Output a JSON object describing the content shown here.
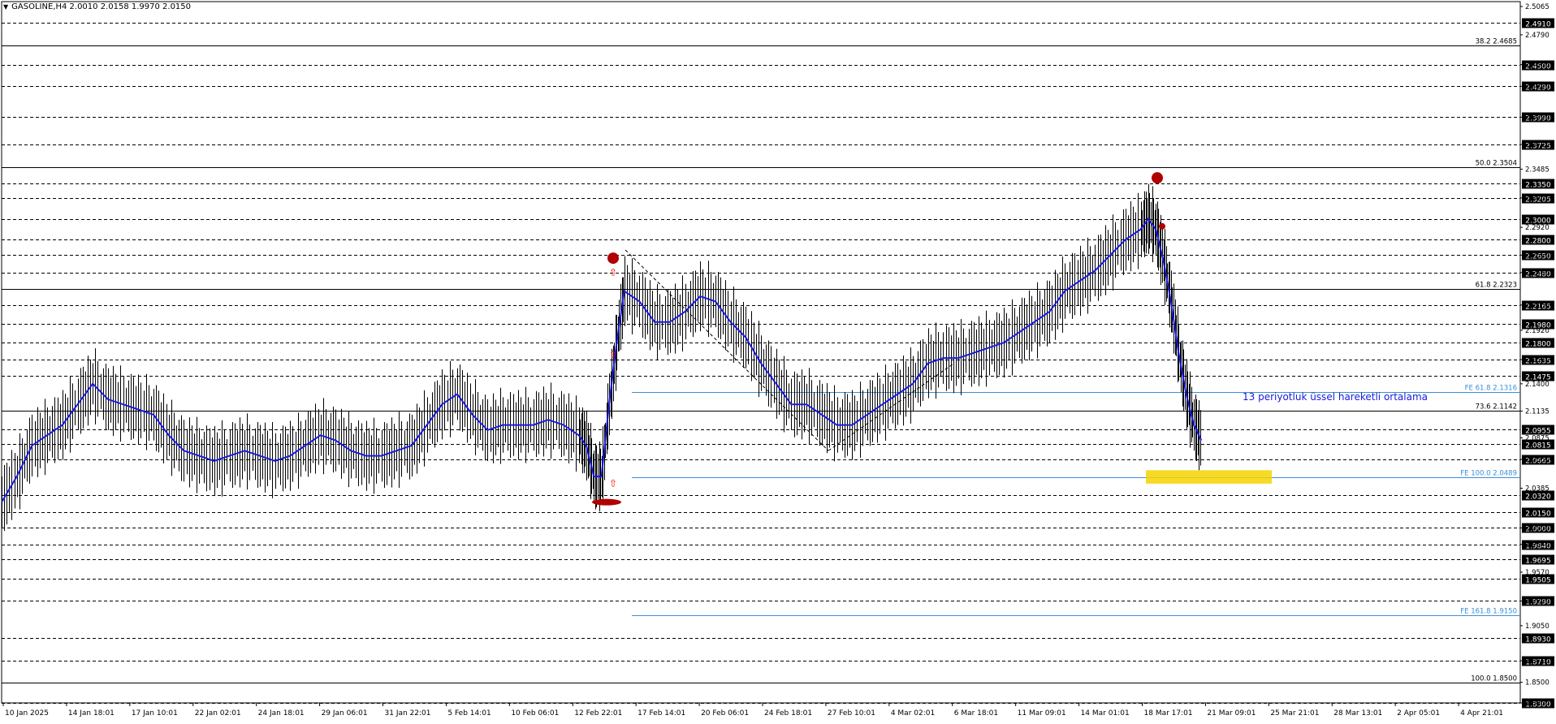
{
  "header": {
    "symbol_line": "GASOLINE,H4  2.0010 2.0158 1.9970 2.0150",
    "menu_icon": "triangle-down-icon"
  },
  "annotation": "13 periyotluk üssel hareketli ortalama",
  "colors": {
    "background": "#ffffff",
    "candle": "#000000",
    "ema": "#1a1adc",
    "fib_line": "#000000",
    "fe_line": "#3a8fd6",
    "highlight": "#f5d400",
    "marker_red": "#b10000",
    "arrow_red": "#ff0000",
    "price_box": "#000000"
  },
  "chart_data": {
    "type": "candlestick",
    "instrument": "GASOLINE",
    "timeframe": "H4",
    "ohlc_last": {
      "open": 2.001,
      "high": 2.0158,
      "low": 1.997,
      "close": 2.015
    },
    "ylim": [
      1.83,
      2.5065
    ],
    "y_ticks": [
      "2.5065",
      "2.4790",
      "2.4500",
      "2.4290",
      "2.3990",
      "2.3725",
      "2.3485",
      "2.3205",
      "2.2920",
      "2.2650",
      "2.2480",
      "2.2165",
      "2.1920",
      "2.1635",
      "2.1400",
      "2.1135",
      "2.0875",
      "2.0665",
      "2.0385",
      "2.0000",
      "1.9840",
      "1.9570",
      "1.9290",
      "1.9050",
      "1.8710",
      "1.8500",
      "1.8300"
    ],
    "price_boxes": [
      "2.4910",
      "2.4500",
      "2.4290",
      "2.3990",
      "2.3725",
      "2.3350",
      "2.3205",
      "2.3000",
      "2.2800",
      "2.2650",
      "2.2480",
      "2.2165",
      "2.1980",
      "2.1800",
      "2.1635",
      "2.1475",
      "2.0955",
      "2.0815",
      "2.0665",
      "2.0320",
      "2.0150",
      "2.0000",
      "1.9840",
      "1.9695",
      "1.9505",
      "1.9290",
      "1.8930",
      "1.8710",
      "1.8300"
    ],
    "x_labels": [
      "10 Jan 2025",
      "14 Jan 18:01",
      "17 Jan 10:01",
      "22 Jan 02:01",
      "24 Jan 18:01",
      "29 Jan 06:01",
      "31 Jan 22:01",
      "5 Feb 14:01",
      "10 Feb 06:01",
      "12 Feb 22:01",
      "17 Feb 14:01",
      "20 Feb 06:01",
      "24 Feb 18:01",
      "27 Feb 10:01",
      "4 Mar 02:01",
      "6 Mar 18:01",
      "11 Mar 09:01",
      "14 Mar 01:01",
      "18 Mar 17:01",
      "21 Mar 09:01",
      "25 Mar 21:01",
      "28 Mar 13:01",
      "2 Apr 05:01",
      "4 Apr 21:01"
    ],
    "fib_levels": [
      {
        "label": "38.2",
        "value": "2.4685"
      },
      {
        "label": "50.0",
        "value": "2.3504"
      },
      {
        "label": "61.8",
        "value": "2.2323"
      },
      {
        "label": "73.6",
        "value": "2.1142"
      },
      {
        "label": "100.0",
        "value": "1.8500"
      }
    ],
    "fe_levels": [
      {
        "label": "FE 61.8",
        "value": "2.1316"
      },
      {
        "label": "FE 100.0",
        "value": "2.0489"
      },
      {
        "label": "FE 161.8",
        "value": "1.9150"
      }
    ],
    "ema_path": [
      [
        0,
        2.025
      ],
      [
        0.01,
        2.05
      ],
      [
        0.02,
        2.08
      ],
      [
        0.03,
        2.09
      ],
      [
        0.04,
        2.1
      ],
      [
        0.05,
        2.12
      ],
      [
        0.06,
        2.14
      ],
      [
        0.07,
        2.125
      ],
      [
        0.08,
        2.12
      ],
      [
        0.09,
        2.115
      ],
      [
        0.1,
        2.11
      ],
      [
        0.11,
        2.09
      ],
      [
        0.12,
        2.075
      ],
      [
        0.13,
        2.07
      ],
      [
        0.14,
        2.065
      ],
      [
        0.15,
        2.07
      ],
      [
        0.16,
        2.075
      ],
      [
        0.17,
        2.07
      ],
      [
        0.18,
        2.065
      ],
      [
        0.19,
        2.07
      ],
      [
        0.2,
        2.08
      ],
      [
        0.21,
        2.09
      ],
      [
        0.22,
        2.085
      ],
      [
        0.23,
        2.075
      ],
      [
        0.24,
        2.07
      ],
      [
        0.25,
        2.07
      ],
      [
        0.26,
        2.075
      ],
      [
        0.27,
        2.08
      ],
      [
        0.28,
        2.1
      ],
      [
        0.29,
        2.12
      ],
      [
        0.3,
        2.13
      ],
      [
        0.31,
        2.11
      ],
      [
        0.32,
        2.095
      ],
      [
        0.33,
        2.1
      ],
      [
        0.34,
        2.1
      ],
      [
        0.35,
        2.1
      ],
      [
        0.36,
        2.105
      ],
      [
        0.37,
        2.1
      ],
      [
        0.38,
        2.09
      ],
      [
        0.385,
        2.08
      ],
      [
        0.39,
        2.05
      ],
      [
        0.395,
        2.05
      ],
      [
        0.4,
        2.12
      ],
      [
        0.405,
        2.18
      ],
      [
        0.41,
        2.23
      ],
      [
        0.42,
        2.22
      ],
      [
        0.43,
        2.2
      ],
      [
        0.44,
        2.2
      ],
      [
        0.45,
        2.21
      ],
      [
        0.46,
        2.225
      ],
      [
        0.47,
        2.22
      ],
      [
        0.48,
        2.2
      ],
      [
        0.49,
        2.185
      ],
      [
        0.5,
        2.16
      ],
      [
        0.51,
        2.14
      ],
      [
        0.52,
        2.12
      ],
      [
        0.53,
        2.12
      ],
      [
        0.54,
        2.11
      ],
      [
        0.55,
        2.1
      ],
      [
        0.56,
        2.1
      ],
      [
        0.57,
        2.11
      ],
      [
        0.58,
        2.12
      ],
      [
        0.59,
        2.13
      ],
      [
        0.6,
        2.14
      ],
      [
        0.61,
        2.16
      ],
      [
        0.62,
        2.165
      ],
      [
        0.63,
        2.165
      ],
      [
        0.64,
        2.17
      ],
      [
        0.65,
        2.175
      ],
      [
        0.66,
        2.18
      ],
      [
        0.67,
        2.19
      ],
      [
        0.68,
        2.2
      ],
      [
        0.69,
        2.21
      ],
      [
        0.7,
        2.23
      ],
      [
        0.71,
        2.24
      ],
      [
        0.72,
        2.25
      ],
      [
        0.73,
        2.265
      ],
      [
        0.74,
        2.28
      ],
      [
        0.75,
        2.29
      ],
      [
        0.755,
        2.3
      ],
      [
        0.76,
        2.29
      ],
      [
        0.765,
        2.26
      ],
      [
        0.77,
        2.22
      ],
      [
        0.775,
        2.17
      ],
      [
        0.78,
        2.13
      ],
      [
        0.785,
        2.1
      ],
      [
        0.79,
        2.085
      ]
    ]
  }
}
